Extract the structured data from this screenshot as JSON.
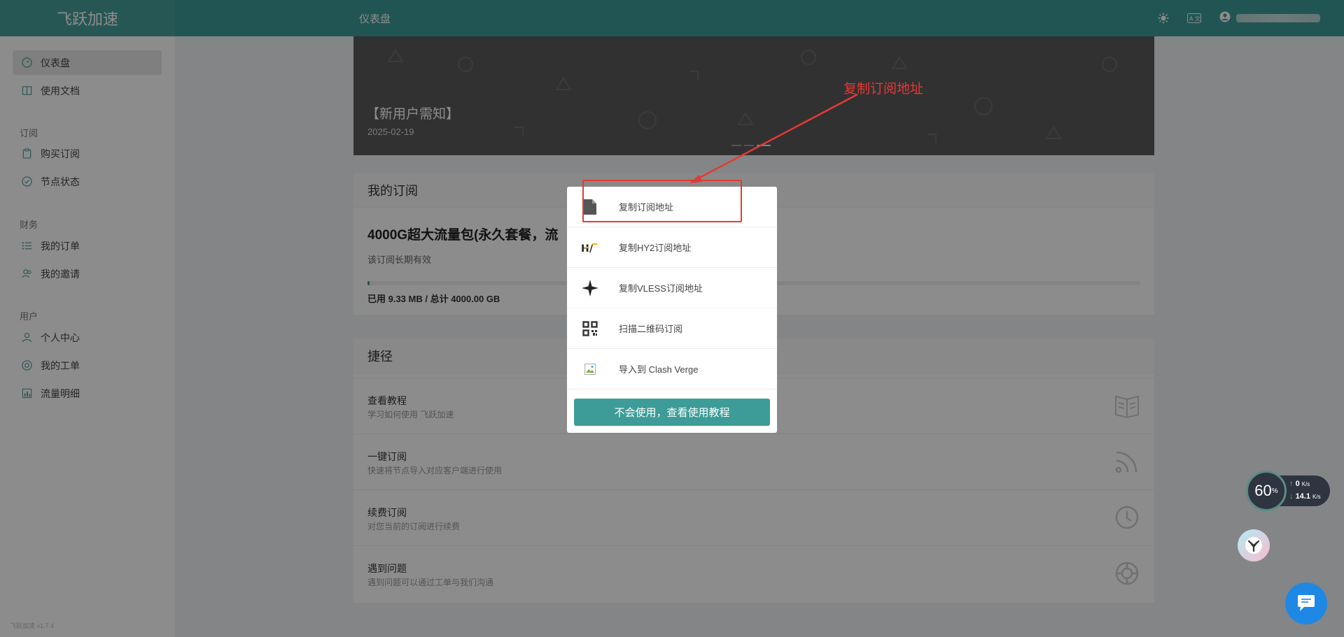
{
  "app": {
    "brand": "飞跃加速",
    "version": "飞跃加速 v1.7.4"
  },
  "topbar": {
    "page_title": "仪表盘",
    "theme_icon": "sun-icon",
    "lang_icon": "translate-icon",
    "user_icon": "user-circle-icon"
  },
  "sidebar": {
    "items": [
      {
        "label": "仪表盘",
        "icon": "dashboard-icon"
      },
      {
        "label": "使用文档",
        "icon": "book-icon"
      },
      {
        "label": "购买订阅",
        "icon": "clipboard-icon"
      },
      {
        "label": "节点状态",
        "icon": "check-circle-icon"
      },
      {
        "label": "我的订单",
        "icon": "list-icon"
      },
      {
        "label": "我的邀请",
        "icon": "users-icon"
      },
      {
        "label": "个人中心",
        "icon": "user-icon"
      },
      {
        "label": "我的工单",
        "icon": "lifebuoy-icon"
      },
      {
        "label": "流量明细",
        "icon": "bar-chart-icon"
      }
    ],
    "groups": [
      "订阅",
      "财务",
      "用户"
    ]
  },
  "banner": {
    "title": "【新用户需知】",
    "date": "2025-02-19"
  },
  "subscription": {
    "heading": "我的订阅",
    "plan": "4000G超大流量包(永久套餐，流",
    "validity": "该订阅长期有效",
    "usage_text": "已用 9.33 MB / 总计 4000.00 GB",
    "used_fraction": 0.0023
  },
  "shortcuts": {
    "heading": "捷径",
    "items": [
      {
        "title": "查看教程",
        "desc": "学习如何使用 飞跃加速",
        "icon": "book-open-icon"
      },
      {
        "title": "一键订阅",
        "desc": "快速将节点导入对应客户端进行使用",
        "icon": "rss-icon"
      },
      {
        "title": "续费订阅",
        "desc": "对您当前的订阅进行续费",
        "icon": "clock-icon"
      },
      {
        "title": "遇到问题",
        "desc": "遇到问题可以通过工单与我们沟通",
        "icon": "lifebuoy-icon"
      }
    ]
  },
  "popup": {
    "items": [
      {
        "label": "复制订阅地址",
        "icon": "file-icon"
      },
      {
        "label": "复制HY2订阅地址",
        "icon": "hy2-icon"
      },
      {
        "label": "复制VLESS订阅地址",
        "icon": "vless-star-icon"
      },
      {
        "label": "扫描二维码订阅",
        "icon": "qrcode-icon"
      },
      {
        "label": "导入到 Clash Verge",
        "icon": "broken-image-icon"
      }
    ],
    "button_label": "不会使用，查看使用教程"
  },
  "annotation": {
    "text": "复制订阅地址",
    "color": "#e53935"
  },
  "speed_widget": {
    "percent": "60",
    "percent_unit": "%",
    "up": "0",
    "up_unit": "K/s",
    "down": "14.1",
    "down_unit": "K/s"
  }
}
